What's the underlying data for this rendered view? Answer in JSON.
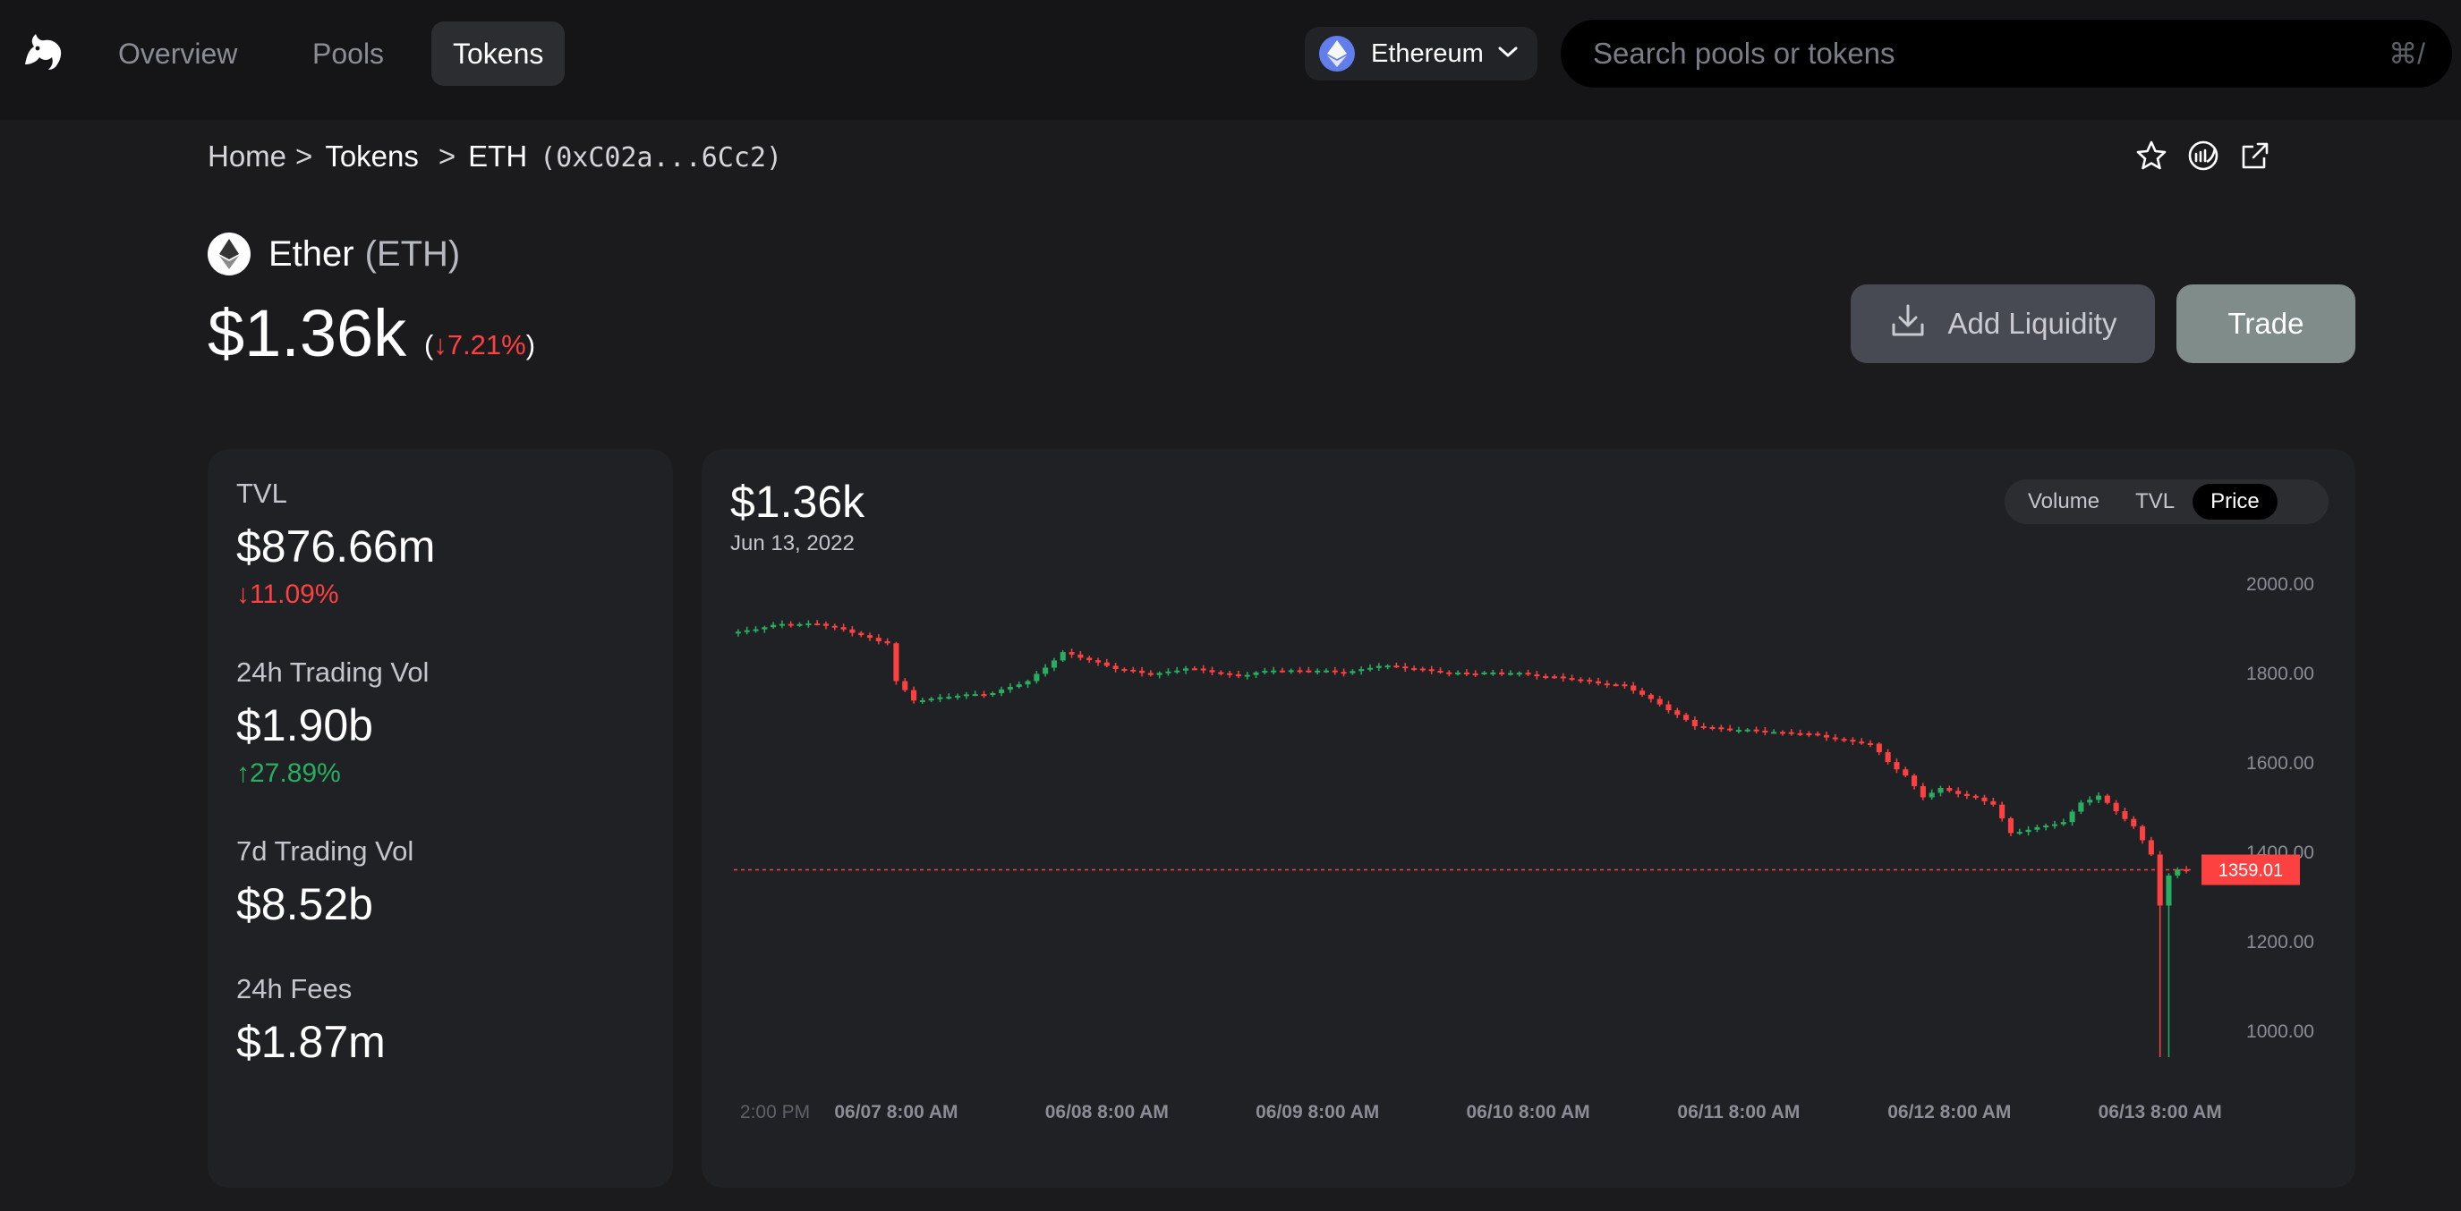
{
  "nav": {
    "items": [
      {
        "label": "Overview"
      },
      {
        "label": "Pools"
      },
      {
        "label": "Tokens"
      }
    ],
    "active_index": 2,
    "network": {
      "label": "Ethereum",
      "icon": "ethereum-icon",
      "color": "#627eea"
    },
    "search": {
      "placeholder": "Search pools or tokens",
      "shortcut": "⌘/"
    }
  },
  "breadcrumb": {
    "home": "Home",
    "tokens": "Tokens",
    "current": "ETH",
    "address": "(0xC02a...6Cc2)",
    "separator": ">"
  },
  "top_actions": [
    "star-icon",
    "etherscan-icon",
    "external-link-icon"
  ],
  "token": {
    "name": "Ether",
    "symbol": "(ETH)",
    "price": "$1.36k",
    "change_open": "(",
    "change_arrow": "↓",
    "change": "7.21%",
    "change_close": ")"
  },
  "actions": {
    "add_liquidity": "Add Liquidity",
    "trade": "Trade"
  },
  "stats": [
    {
      "label": "TVL",
      "value": "$876.66m",
      "arrow": "↓",
      "change": "11.09%",
      "direction": "down"
    },
    {
      "label": "24h Trading Vol",
      "value": "$1.90b",
      "arrow": "↑",
      "change": "27.89%",
      "direction": "up"
    },
    {
      "label": "7d Trading Vol",
      "value": "$8.52b",
      "arrow": "",
      "change": "",
      "direction": "none"
    },
    {
      "label": "24h Fees",
      "value": "$1.87m",
      "arrow": "",
      "change": "",
      "direction": "none"
    }
  ],
  "chart_header": {
    "price": "$1.36k",
    "date": "Jun 13, 2022"
  },
  "chart_toggle": {
    "options": [
      "Volume",
      "TVL",
      "Price"
    ],
    "active": "Price"
  },
  "colors": {
    "up": "#27ae60",
    "down": "#fd4040",
    "price_line": "#fd4040",
    "accent_trade": "#7f8c8a"
  },
  "chart_data": {
    "type": "candlestick",
    "title": "",
    "xlabel": "",
    "ylabel": "",
    "ylim": [
      860,
      2100
    ],
    "y_ticks": [
      "2000.00",
      "1800.00",
      "1600.00",
      "1400.00",
      "1200.00",
      "1000.00"
    ],
    "y_tick_values": [
      2000,
      1800,
      1600,
      1400,
      1200,
      1000
    ],
    "x_ticks": [
      "2:00 PM",
      "06/07 8:00 AM",
      "06/08 8:00 AM",
      "06/09 8:00 AM",
      "06/10 8:00 AM",
      "06/11 8:00 AM",
      "06/12 8:00 AM",
      "06/13 8:00 AM"
    ],
    "x_tick_hours": [
      -18,
      0,
      24,
      48,
      72,
      96,
      120,
      144
    ],
    "x_range_hours": [
      -18.5,
      147.5
    ],
    "current_price": 1359.01,
    "current_price_label": "1359.01",
    "path_hours": [
      -18,
      -12,
      -8,
      -3,
      -1,
      0.3,
      1,
      3,
      8,
      12,
      16,
      20,
      26,
      30,
      34,
      40,
      44,
      48,
      52,
      56,
      60,
      64,
      68,
      72,
      76,
      80,
      84,
      88,
      92,
      97,
      100,
      104,
      112,
      114,
      116,
      118,
      120,
      124,
      126,
      128,
      130,
      134,
      136,
      138,
      140,
      142,
      144,
      145,
      146,
      147
    ],
    "path_prices": [
      1888,
      1908,
      1910,
      1885,
      1870,
      1865,
      1780,
      1738,
      1748,
      1755,
      1780,
      1845,
      1810,
      1795,
      1810,
      1793,
      1805,
      1805,
      1800,
      1815,
      1810,
      1798,
      1800,
      1798,
      1790,
      1780,
      1770,
      1730,
      1680,
      1672,
      1668,
      1665,
      1640,
      1600,
      1570,
      1522,
      1540,
      1520,
      1505,
      1440,
      1450,
      1465,
      1510,
      1525,
      1490,
      1455,
      1395,
      1280,
      1345,
      1359
    ]
  }
}
